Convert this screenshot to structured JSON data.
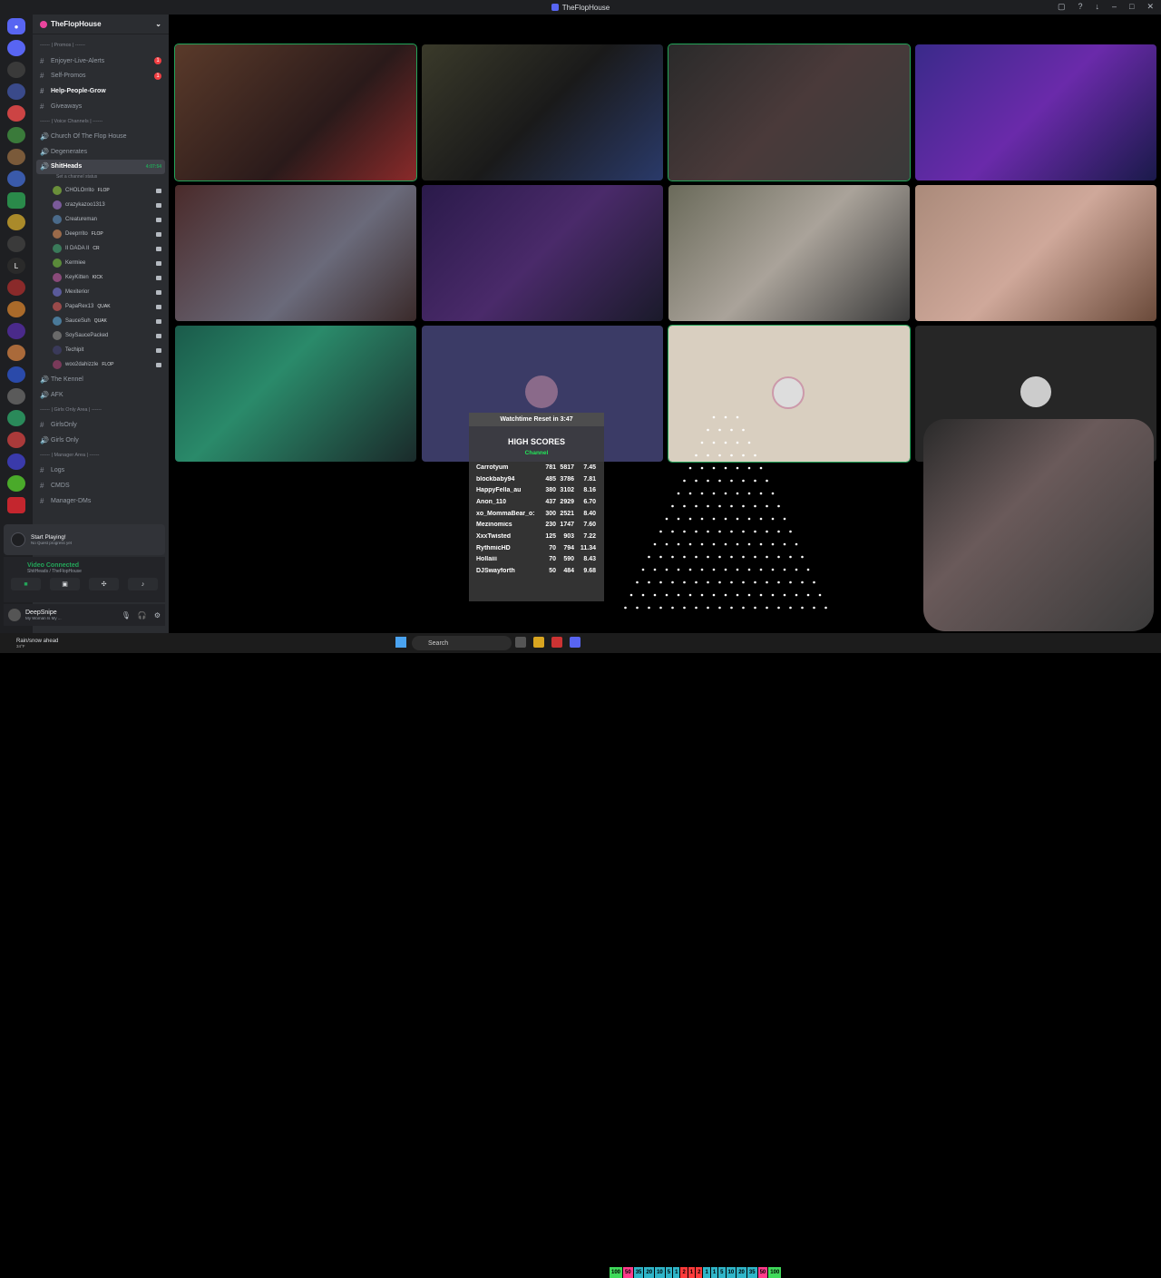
{
  "window": {
    "title": "TheFlopHouse"
  },
  "guild": {
    "name": "TheFlopHouse"
  },
  "channels": [
    {
      "type": "category",
      "label": "------ | Promos | ------"
    },
    {
      "type": "text",
      "label": "Enjoyer-Live-Alerts",
      "badge": "1"
    },
    {
      "type": "text",
      "label": "Self-Promos",
      "badge": "1"
    },
    {
      "type": "text",
      "label": "Help-People-Grow",
      "bold": true
    },
    {
      "type": "text",
      "label": "Giveaways"
    },
    {
      "type": "category",
      "label": "------ | Voice Channels | ------"
    },
    {
      "type": "voice",
      "label": "Church Of The Flop House"
    },
    {
      "type": "voice",
      "label": "Degenerates"
    },
    {
      "type": "voice",
      "label": "ShitHeads",
      "selected": true,
      "time": "4:07:54"
    }
  ],
  "channel_status_placeholder": "Set a channel status",
  "members": [
    {
      "name": "CHOLOrrito",
      "tag": "FLOP",
      "color": "#6a8f3a"
    },
    {
      "name": "crazykazoo1313",
      "tag": "",
      "color": "#7a5a9a"
    },
    {
      "name": "Creatureman",
      "tag": "",
      "color": "#4a6a8a"
    },
    {
      "name": "Deeprrito",
      "tag": "FLOP",
      "color": "#9a6a4a"
    },
    {
      "name": "II DADA II",
      "tag": "CR",
      "color": "#3a7a5a"
    },
    {
      "name": "Kermiee",
      "tag": "",
      "color": "#5a8a3a"
    },
    {
      "name": "KeyKitten",
      "tag": "KICK",
      "color": "#8a4a7a"
    },
    {
      "name": "Mexiterior",
      "tag": "",
      "color": "#5a5a9a"
    },
    {
      "name": "PapaRex13",
      "tag": "QUAK",
      "color": "#9a4a4a"
    },
    {
      "name": "SauceSuh",
      "tag": "QUAK",
      "color": "#4a7a9a"
    },
    {
      "name": "SoySaucePacked",
      "tag": "",
      "color": "#6a6a6a"
    },
    {
      "name": "Techipit",
      "tag": "",
      "color": "#3a3a5a"
    },
    {
      "name": "woo2dahizzle",
      "tag": "FLOP",
      "color": "#7a3a5a"
    }
  ],
  "channels_after": [
    {
      "type": "voice",
      "label": "The Kennel"
    },
    {
      "type": "voice",
      "label": "AFK"
    },
    {
      "type": "category",
      "label": "------ | Girls Only Area | ------"
    },
    {
      "type": "text",
      "label": "GirlsOnly"
    },
    {
      "type": "voice",
      "label": "Girls Only"
    },
    {
      "type": "category",
      "label": "------ | Manager Area | ------"
    },
    {
      "type": "text",
      "label": "Logs"
    },
    {
      "type": "text",
      "label": "CMDS"
    },
    {
      "type": "text",
      "label": "Manager-DMs"
    }
  ],
  "quest": {
    "title": "Start Playing!",
    "sub": "No Quest progress yet"
  },
  "voice": {
    "status": "Video Connected",
    "location": "ShitHeads / TheFlopHouse"
  },
  "user": {
    "name": "DeepSnipe",
    "status": "My Woman Is My ..."
  },
  "overlay": {
    "watchtime": "Watchtime Reset in 3:47",
    "title": "HIGH SCORES",
    "subtitle": "Channel",
    "rows": [
      [
        "Carrotyum",
        "781",
        "5817",
        "7.45"
      ],
      [
        "blockbaby94",
        "485",
        "3786",
        "7.81"
      ],
      [
        "HappyFella_au",
        "380",
        "3102",
        "8.16"
      ],
      [
        "Anon_110",
        "437",
        "2929",
        "6.70"
      ],
      [
        "xo_MommaBear_o:",
        "300",
        "2521",
        "8.40"
      ],
      [
        "Mezinomics",
        "230",
        "1747",
        "7.60"
      ],
      [
        "XxxTwisted",
        "125",
        "903",
        "7.22"
      ],
      [
        "RythmicHD",
        "70",
        "794",
        "11.34"
      ],
      [
        "Hollaiii",
        "70",
        "590",
        "8.43"
      ],
      [
        "DJSwayforth",
        "50",
        "484",
        "9.68"
      ]
    ]
  },
  "taskbar": {
    "weather": "Rain/snow ahead",
    "weather_sub": "34°F",
    "search": "Search",
    "pegs": [
      "100",
      "50",
      "35",
      "20",
      "10",
      "5",
      "1",
      "2",
      "1",
      "2",
      "1",
      "1",
      "5",
      "10",
      "20",
      "35",
      "50",
      "100"
    ]
  },
  "colors": {
    "speaking": "#23a559",
    "accent": "#5865f2",
    "sidebar": "#2b2d31",
    "rail": "#1e1f22"
  }
}
